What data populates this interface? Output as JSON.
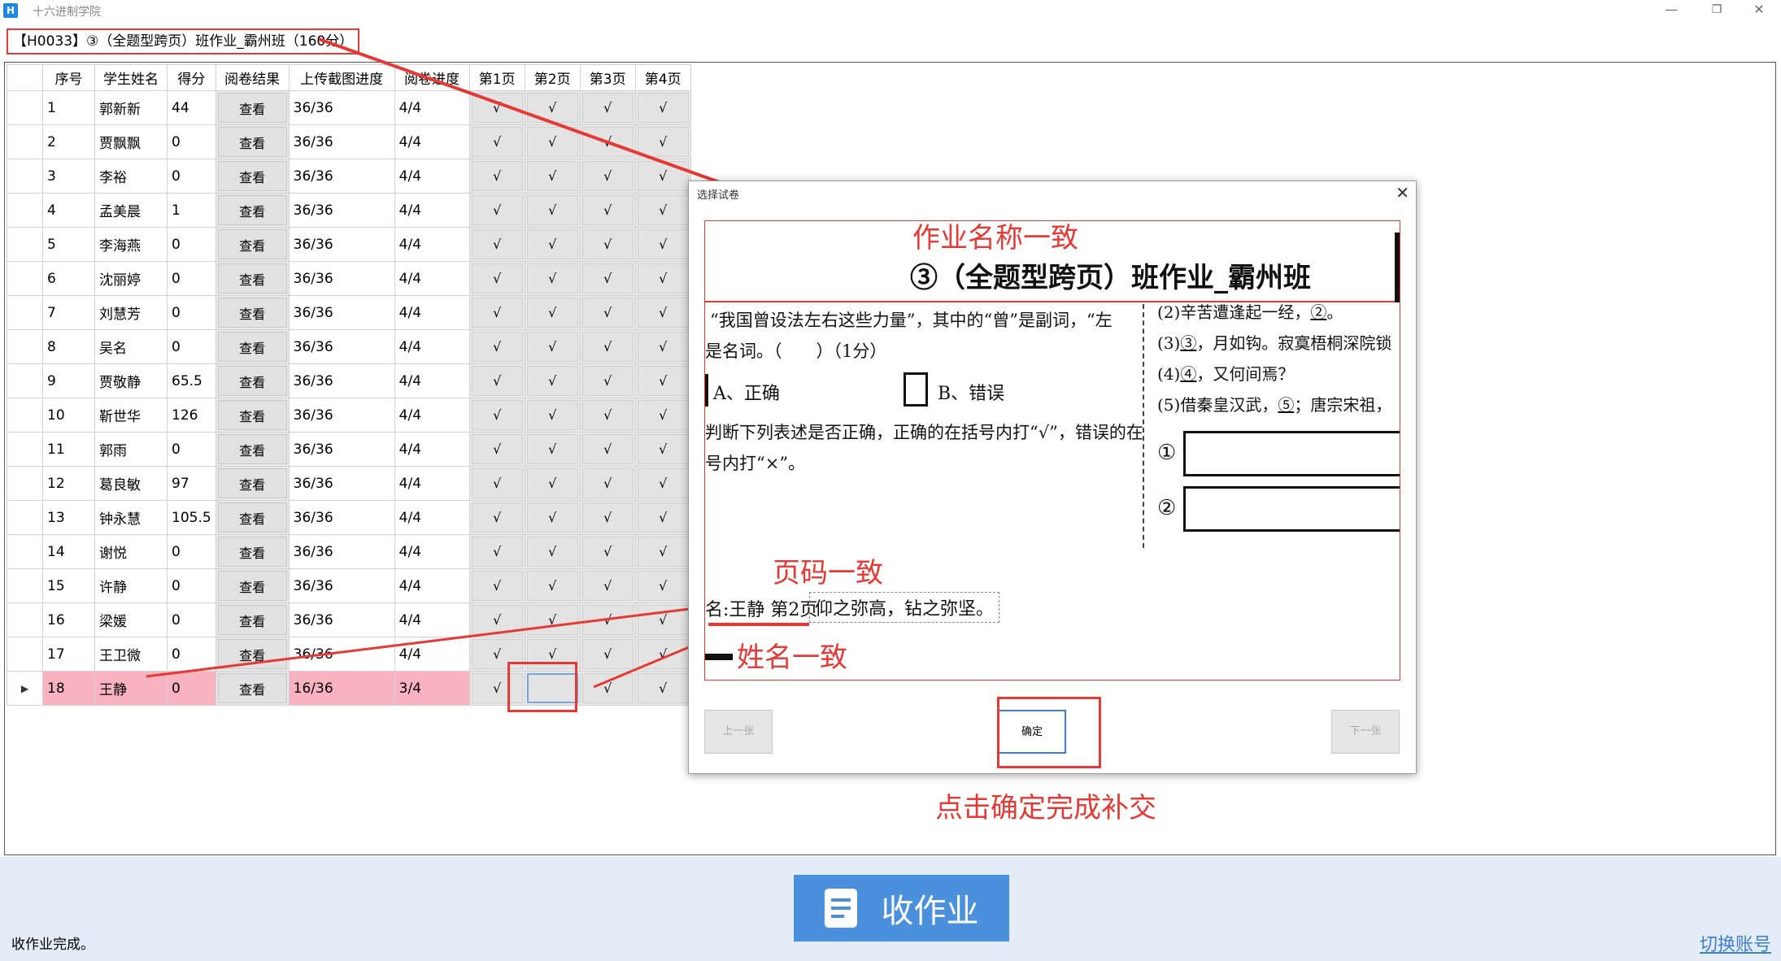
{
  "window": {
    "app_title": "十六进制学院",
    "icon_letter": "H",
    "minimize": "—",
    "restore": "❐",
    "close": "✕"
  },
  "homework_title": "【H0033】③（全题型跨页）班作业_霸州班（160分）",
  "table": {
    "headers": [
      "序号",
      "学生姓名",
      "得分",
      "阅卷结果",
      "上传截图进度",
      "阅卷进度",
      "第1页",
      "第2页",
      "第3页",
      "第4页"
    ],
    "view_label": "查看",
    "check": "√",
    "row_pointer": "▶",
    "rows": [
      {
        "no": "1",
        "name": "郭新新",
        "score": "44",
        "upload": "36/36",
        "review": "4/4",
        "pages": [
          "√",
          "√",
          "√",
          "√"
        ]
      },
      {
        "no": "2",
        "name": "贾飘飘",
        "score": "0",
        "upload": "36/36",
        "review": "4/4",
        "pages": [
          "√",
          "√",
          "√",
          "√"
        ]
      },
      {
        "no": "3",
        "name": "李裕",
        "score": "0",
        "upload": "36/36",
        "review": "4/4",
        "pages": [
          "√",
          "√",
          "√",
          "√"
        ]
      },
      {
        "no": "4",
        "name": "孟美晨",
        "score": "1",
        "upload": "36/36",
        "review": "4/4",
        "pages": [
          "√",
          "√",
          "√",
          "√"
        ]
      },
      {
        "no": "5",
        "name": "李海燕",
        "score": "0",
        "upload": "36/36",
        "review": "4/4",
        "pages": [
          "√",
          "√",
          "√",
          "√"
        ]
      },
      {
        "no": "6",
        "name": "沈丽婷",
        "score": "0",
        "upload": "36/36",
        "review": "4/4",
        "pages": [
          "√",
          "√",
          "√",
          "√"
        ]
      },
      {
        "no": "7",
        "name": "刘慧芳",
        "score": "0",
        "upload": "36/36",
        "review": "4/4",
        "pages": [
          "√",
          "√",
          "√",
          "√"
        ]
      },
      {
        "no": "8",
        "name": "吴名",
        "score": "0",
        "upload": "36/36",
        "review": "4/4",
        "pages": [
          "√",
          "√",
          "√",
          "√"
        ]
      },
      {
        "no": "9",
        "name": "贾敬静",
        "score": "65.5",
        "upload": "36/36",
        "review": "4/4",
        "pages": [
          "√",
          "√",
          "√",
          "√"
        ]
      },
      {
        "no": "10",
        "name": "靳世华",
        "score": "126",
        "upload": "36/36",
        "review": "4/4",
        "pages": [
          "√",
          "√",
          "√",
          "√"
        ]
      },
      {
        "no": "11",
        "name": "郭雨",
        "score": "0",
        "upload": "36/36",
        "review": "4/4",
        "pages": [
          "√",
          "√",
          "√",
          "√"
        ]
      },
      {
        "no": "12",
        "name": "葛良敏",
        "score": "97",
        "upload": "36/36",
        "review": "4/4",
        "pages": [
          "√",
          "√",
          "√",
          "√"
        ]
      },
      {
        "no": "13",
        "name": "钟永慧",
        "score": "105.5",
        "upload": "36/36",
        "review": "4/4",
        "pages": [
          "√",
          "√",
          "√",
          "√"
        ]
      },
      {
        "no": "14",
        "name": "谢悦",
        "score": "0",
        "upload": "36/36",
        "review": "4/4",
        "pages": [
          "√",
          "√",
          "√",
          "√"
        ]
      },
      {
        "no": "15",
        "name": "许静",
        "score": "0",
        "upload": "36/36",
        "review": "4/4",
        "pages": [
          "√",
          "√",
          "√",
          "√"
        ]
      },
      {
        "no": "16",
        "name": "梁媛",
        "score": "0",
        "upload": "36/36",
        "review": "4/4",
        "pages": [
          "√",
          "√",
          "√",
          "√"
        ]
      },
      {
        "no": "17",
        "name": "王卫微",
        "score": "0",
        "upload": "36/36",
        "review": "4/4",
        "pages": [
          "√",
          "√",
          "√",
          "√"
        ]
      },
      {
        "no": "18",
        "name": "王静",
        "score": "0",
        "upload": "16/36",
        "review": "3/4",
        "pages": [
          "√",
          "",
          "√",
          "√"
        ]
      }
    ]
  },
  "dialog": {
    "title": "选择试卷",
    "close": "✕",
    "paper": {
      "header_title": "③（全题型跨页）班作业_霸州班",
      "q_text_1": "“我国曾设法左右这些力量”，其中的“曾”是副词，“左",
      "q_text_2": "是名词。（　　）（1分）",
      "option_a": "A、正确",
      "option_b": "B、错误",
      "q_text_3": "判断下列表述是否正确，正确的在括号内打“√”，错误的在",
      "q_text_4": "号内打“×”。",
      "right_1": "(2)辛苦遭逢起一经，",
      "right_1_blank": "②",
      "right_2_pre": "(3)",
      "right_2_blank": "③",
      "right_2": "，月如钩。寂寞梧桐深院锁",
      "right_3_pre": "(4)",
      "right_3_blank": "④",
      "right_3": "，又何间焉？",
      "right_4": "(5)借秦皇汉武，",
      "right_4_blank": "⑤",
      "right_4b": "；唐宗宋祖，",
      "circle_1": "①",
      "circle_2": "②",
      "footer_name": "名:王静 第2页",
      "footer_verse": "仰之弥高，钻之弥坚。"
    },
    "prev_label": "上一张",
    "ok_label": "确定",
    "next_label": "下一张"
  },
  "annotations": {
    "hw_name_match": "作业名称一致",
    "page_match": "页码一致",
    "name_match": "姓名一致",
    "click_ok": "点击确定完成补交"
  },
  "bottom": {
    "collect_label": "收作业",
    "status": "收作业完成。",
    "switch_account": "切换账号"
  },
  "colors": {
    "annotation_red": "#e53935",
    "highlight_row": "#f9b3c0",
    "primary_blue": "#4a90dc",
    "bottom_bg": "#e3ecf7"
  }
}
